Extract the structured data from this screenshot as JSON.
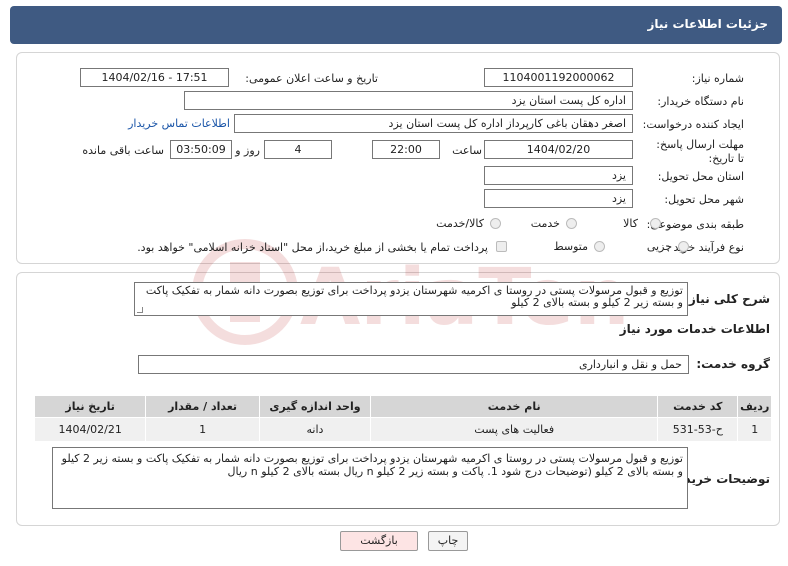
{
  "header": {
    "title": "جزئیات اطلاعات نیاز"
  },
  "fields": {
    "need_number_label": "شماره نیاز:",
    "need_number": "1104001192000062",
    "announce_label": "تاریخ و ساعت اعلان عمومی:",
    "announce_value": "1404/02/16 - 17:51",
    "buyer_org_label": "نام دستگاه خریدار:",
    "buyer_org": "اداره کل پست استان یزد",
    "creator_label": "ایجاد کننده درخواست:",
    "creator": "اصغر دهقان باغی کارپرداز اداره کل پست استان یزد",
    "contact_link": "اطلاعات تماس خریدار",
    "deadline_label": "مهلت ارسال پاسخ: تا تاریخ:",
    "deadline_date": "1404/02/20",
    "time_label": "ساعت",
    "deadline_time": "22:00",
    "days_value": "4",
    "days_label": "روز و",
    "remaining_time": "03:50:09",
    "remaining_label": "ساعت باقی مانده",
    "province_label": "استان محل تحویل:",
    "province": "یزد",
    "city_label": "شهر محل تحویل:",
    "city": "یزد",
    "category_label": "طبقه بندی موضوعی:",
    "category_options": [
      "کالا",
      "خدمت",
      "کالا/خدمت"
    ],
    "process_label": "نوع فرآیند خرید :",
    "process_options": [
      "جزیی",
      "متوسط"
    ],
    "payment_note": "پرداخت تمام یا بخشی از مبلغ خرید،از محل \"اسناد خزانه اسلامی\" خواهد بود."
  },
  "summary": {
    "label": "شرح کلی نیاز:",
    "text": "توزیع و قبول مرسولات پستی در روستا ی اکرمیه شهرستان یزدو پرداخت   برای توزیع بصورت دانه شمار به تفکیک پاکت و بسته زیر 2 کیلو و بسته بالای 2 کیلو"
  },
  "services": {
    "section_title": "اطلاعات خدمات مورد نیاز",
    "group_label": "گروه خدمت:",
    "group_value": "حمل و نقل و انبارداری",
    "columns": [
      "ردیف",
      "کد خدمت",
      "نام خدمت",
      "واحد اندازه گیری",
      "تعداد / مقدار",
      "تاریخ نیاز"
    ],
    "rows": [
      [
        "1",
        "ح-53-531",
        "فعالیت های پست",
        "دانه",
        "1",
        "1404/02/21"
      ]
    ]
  },
  "buyer_notes": {
    "label": "توضیحات خریدار:",
    "text": "توزیع و قبول مرسولات پستی در روستا ی اکرمیه شهرستان یزدو پرداخت   برای توزیع بصورت دانه شمار به تفکیک پاکت و بسته زیر 2 کیلو و بسته بالای 2 کیلو (توضیحات درج شود 1. پاکت و بسته زیر 2 کیلو n  ریال بسته بالای 2 کیلو n  ریال"
  },
  "buttons": {
    "print": "چاپ",
    "back": "بازگشت"
  },
  "watermark": {
    "text": "AriaTender.neT"
  },
  "colors": {
    "header_bg": "#3f5a82",
    "link": "#1a55a8",
    "back_btn_bg": "#fde4e4"
  }
}
